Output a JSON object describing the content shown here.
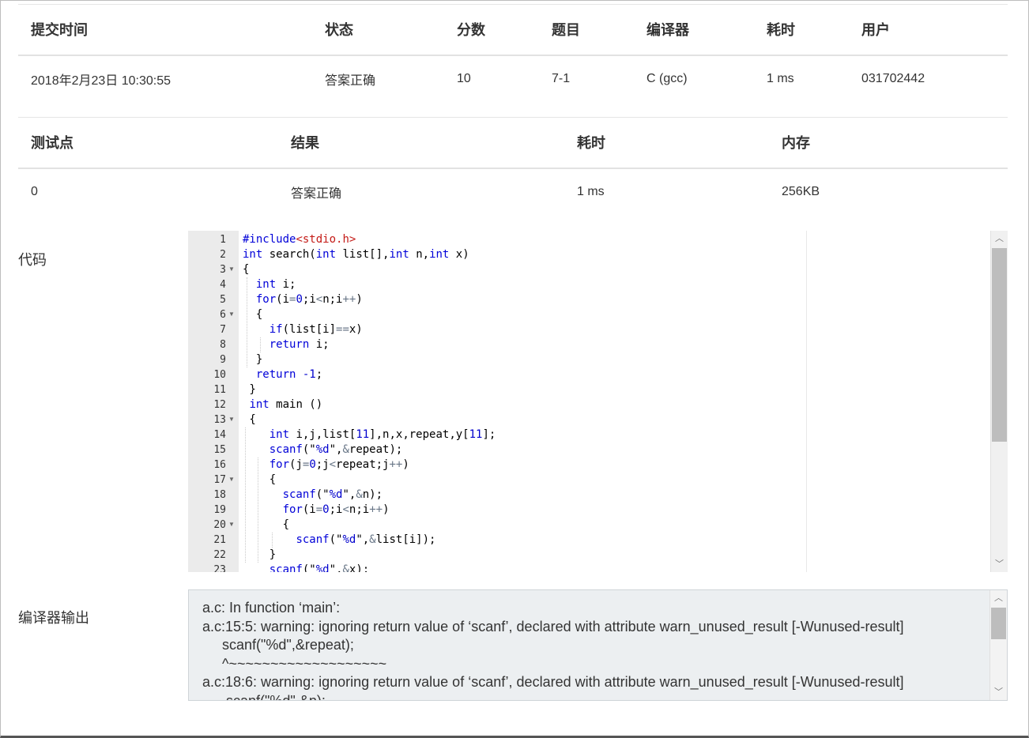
{
  "submission": {
    "headers": [
      "提交时间",
      "状态",
      "分数",
      "题目",
      "编译器",
      "耗时",
      "用户"
    ],
    "row": {
      "time": "2018年2月23日 10:30:55",
      "status": "答案正确",
      "score": "10",
      "problem": "7-1",
      "compiler": "C (gcc)",
      "elapsed": "1 ms",
      "user": "031702442"
    }
  },
  "testcases": {
    "headers": [
      "测试点",
      "结果",
      "耗时",
      "内存"
    ],
    "rows": [
      {
        "id": "0",
        "result": "答案正确",
        "elapsed": "1 ms",
        "memory": "256KB"
      }
    ]
  },
  "code_section": {
    "label": "代码",
    "line_numbers": [
      "1",
      "2",
      "3",
      "4",
      "5",
      "6",
      "7",
      "8",
      "9",
      "10",
      "11",
      "12",
      "13",
      "14",
      "15",
      "16",
      "17",
      "18",
      "19",
      "20",
      "21",
      "22",
      "23"
    ],
    "lines": [
      "#include<stdio.h>",
      "int search(int list[],int n,int x)",
      "{",
      "  int i;",
      "  for(i=0;i<n;i++)",
      "  {",
      "    if(list[i]==x)",
      "    return i;",
      "  }",
      "  return -1;",
      " }",
      " int main ()",
      " {",
      "    int i,j,list[11],n,x,repeat,y[11];",
      "    scanf(\"%d\",&repeat);",
      "    for(j=0;j<repeat;j++)",
      "    {",
      "      scanf(\"%d\",&n);",
      "      for(i=0;i<n;i++)",
      "      {",
      "        scanf(\"%d\",&list[i]);",
      "    }",
      "    scanf(\"%d\",&x);"
    ],
    "fold_lines": [
      "3",
      "6",
      "13",
      "17",
      "20"
    ]
  },
  "compiler_output": {
    "label": "编译器输出",
    "lines": [
      "a.c: In function ‘main’:",
      "a.c:15:5: warning: ignoring return value of ‘scanf’, declared with attribute warn_unused_result [-Wunused-result]",
      "     scanf(\"%d\",&repeat);",
      "     ^~~~~~~~~~~~~~~~~~~~",
      "a.c:18:6: warning: ignoring return value of ‘scanf’, declared with attribute warn_unused_result [-Wunused-result]",
      "      scanf(\"%d\",&n);"
    ]
  },
  "colors": {
    "status_ok": "#e04a3a",
    "link": "#1e6fc2",
    "keyword": "#0000d8",
    "include": "#c41a16"
  }
}
